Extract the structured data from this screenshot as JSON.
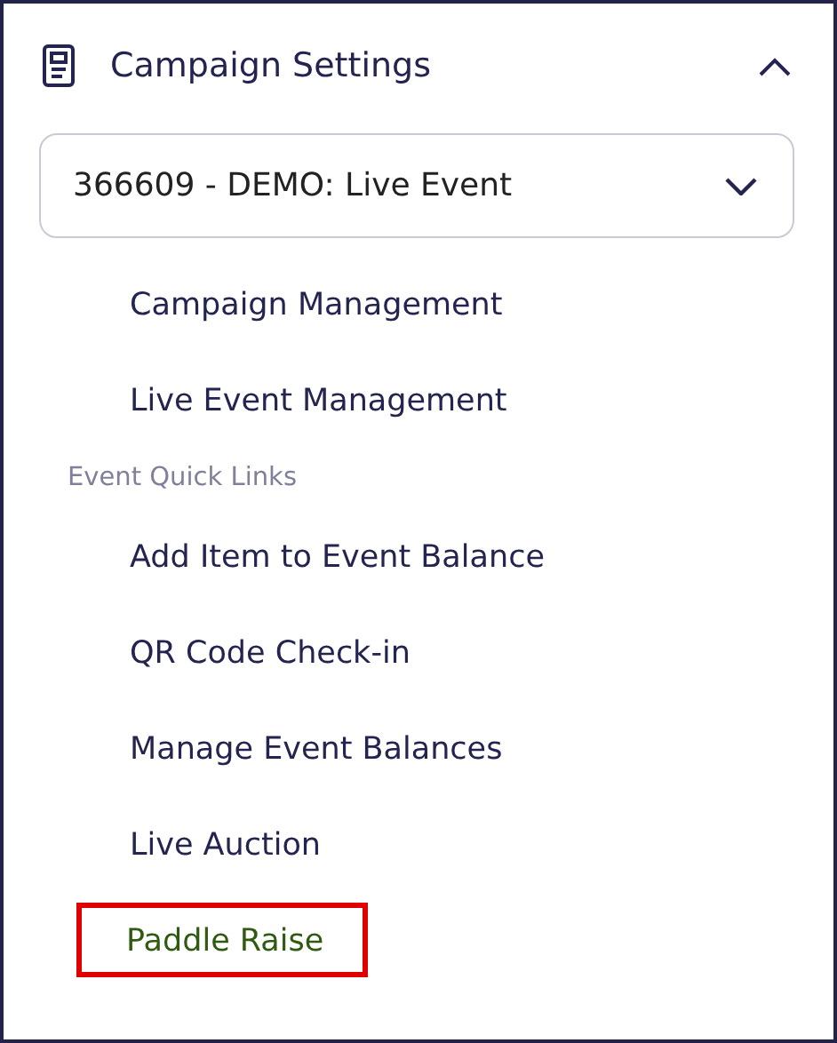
{
  "section": {
    "title": "Campaign Settings",
    "expanded": true
  },
  "campaign_select": {
    "value": "366609 - DEMO: Live Event"
  },
  "links": [
    {
      "label": "Campaign Management",
      "selected": false,
      "highlighted": false
    },
    {
      "label": "Live Event Management",
      "selected": false,
      "highlighted": false
    }
  ],
  "quick_links": {
    "heading": "Event Quick Links",
    "items": [
      {
        "label": "Add Item to Event Balance",
        "selected": false,
        "highlighted": false
      },
      {
        "label": "QR Code Check-in",
        "selected": false,
        "highlighted": false
      },
      {
        "label": "Manage Event Balances",
        "selected": false,
        "highlighted": false
      },
      {
        "label": "Live Auction",
        "selected": false,
        "highlighted": false
      },
      {
        "label": "Paddle Raise",
        "selected": true,
        "highlighted": true
      }
    ]
  }
}
